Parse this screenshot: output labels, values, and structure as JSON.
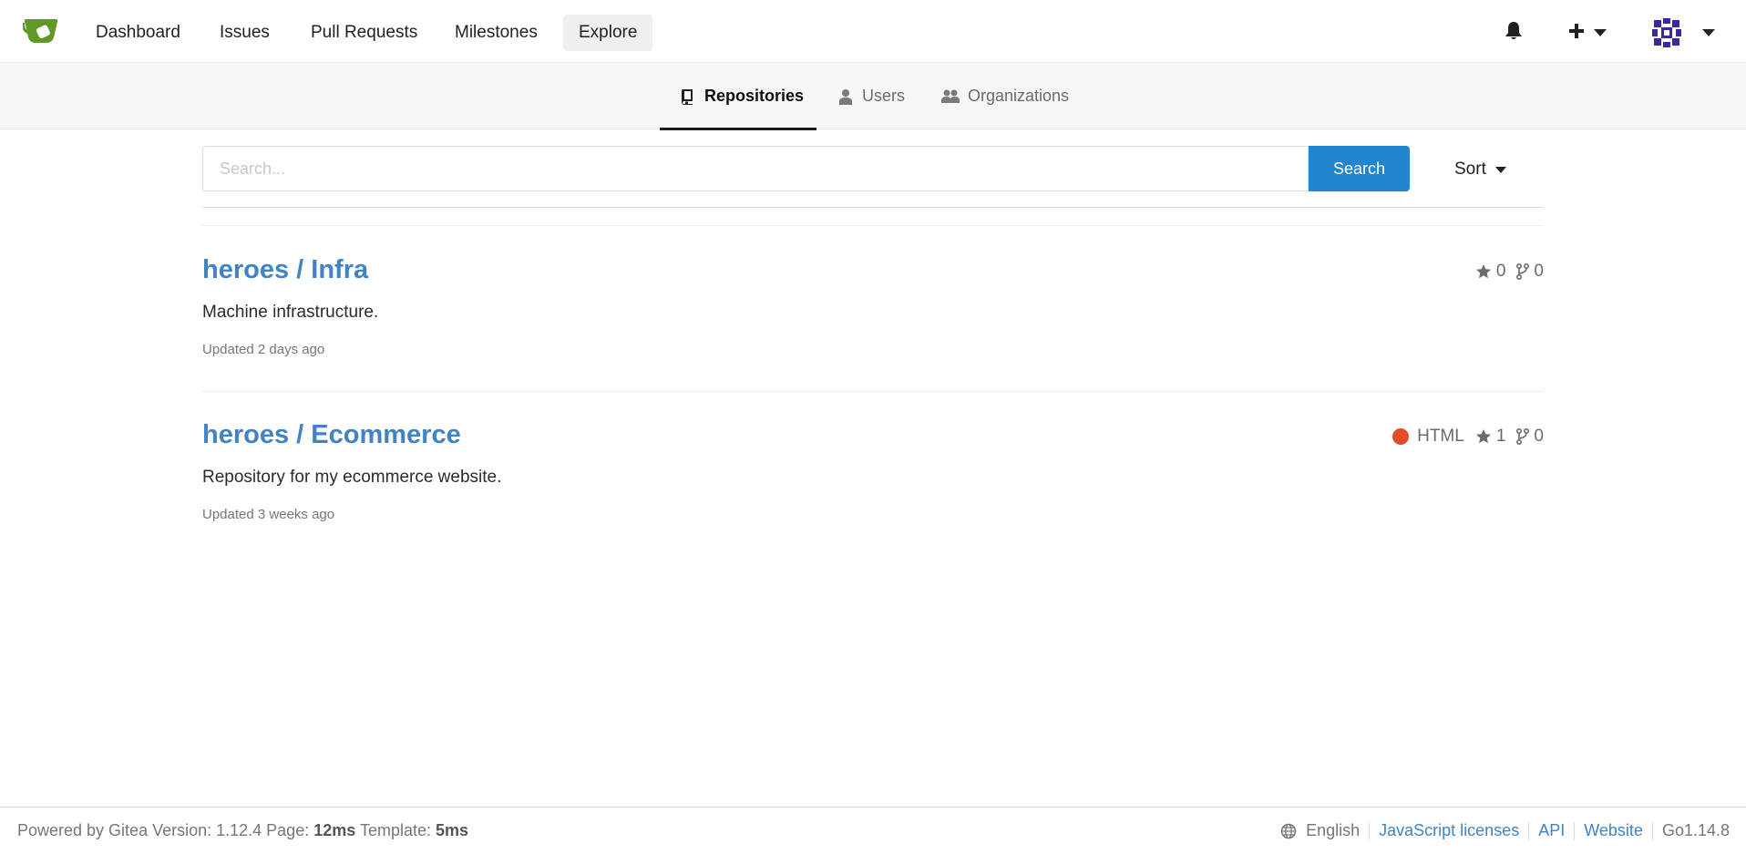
{
  "navbar": {
    "items": [
      {
        "label": "Dashboard"
      },
      {
        "label": "Issues"
      },
      {
        "label": "Pull Requests"
      },
      {
        "label": "Milestones"
      },
      {
        "label": "Explore",
        "active": true
      }
    ],
    "icons": [
      "gitea-logo-icon",
      "bell-icon",
      "plus-icon",
      "chevron-down-icon",
      "avatar"
    ]
  },
  "explore_tabs": [
    {
      "label": "Repositories",
      "icon": "repo-book-icon",
      "active": true
    },
    {
      "label": "Users",
      "icon": "user-icon",
      "active": false
    },
    {
      "label": "Organizations",
      "icon": "organization-icon",
      "active": false
    }
  ],
  "search": {
    "placeholder": "Search...",
    "value": "",
    "button_label": "Search",
    "sort_label": "Sort"
  },
  "repos": [
    {
      "title": "heroes / Infra",
      "description": "Machine infrastructure.",
      "updated": "Updated 2 days ago",
      "language": "",
      "stars": "0",
      "forks": "0"
    },
    {
      "title": "heroes / Ecommerce",
      "description": "Repository for my ecommerce website.",
      "updated": "Updated 3 weeks ago",
      "language": "HTML",
      "language_color": "#e34c26",
      "stars": "1",
      "forks": "0"
    }
  ],
  "footer": {
    "powered_prefix": "Powered by Gitea Version: 1.12.4 Page: ",
    "page_time": "12ms",
    "template_prefix": " Template: ",
    "template_time": "5ms",
    "language": "English",
    "links": [
      "JavaScript licenses",
      "API",
      "Website"
    ],
    "go_version": "Go1.14.8"
  },
  "colors": {
    "accent": "#2185d0",
    "link": "#4183c4",
    "logo_green": "#609926"
  }
}
